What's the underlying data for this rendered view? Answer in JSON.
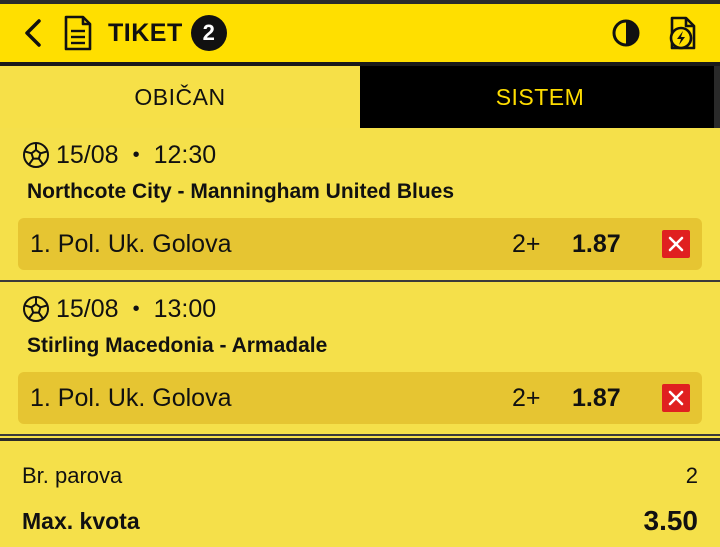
{
  "header": {
    "title": "TIKET",
    "count": "2"
  },
  "tabs": [
    {
      "label": "OBIČAN",
      "active": true
    },
    {
      "label": "SISTEM",
      "active": false
    }
  ],
  "matches": [
    {
      "date": "15/08",
      "time": "12:30",
      "teams": "Northcote City - Manningham United Blues",
      "market": "1. Pol. Uk. Golova",
      "outcome": "2+",
      "odd": "1.87"
    },
    {
      "date": "15/08",
      "time": "13:00",
      "teams": "Stirling Macedonia - Armadale",
      "market": "1. Pol. Uk. Golova",
      "outcome": "2+",
      "odd": "1.87"
    }
  ],
  "summary": {
    "pairs_label": "Br. parova",
    "pairs_value": "2",
    "max_label": "Max. kvota",
    "max_value": "3.50"
  },
  "colors": {
    "header_bg": "#ffdf00",
    "body_bg": "#f5e04a",
    "bet_bg": "#e6c532",
    "remove_red": "#e02020",
    "tab_inactive_text": "#ffdd00"
  }
}
